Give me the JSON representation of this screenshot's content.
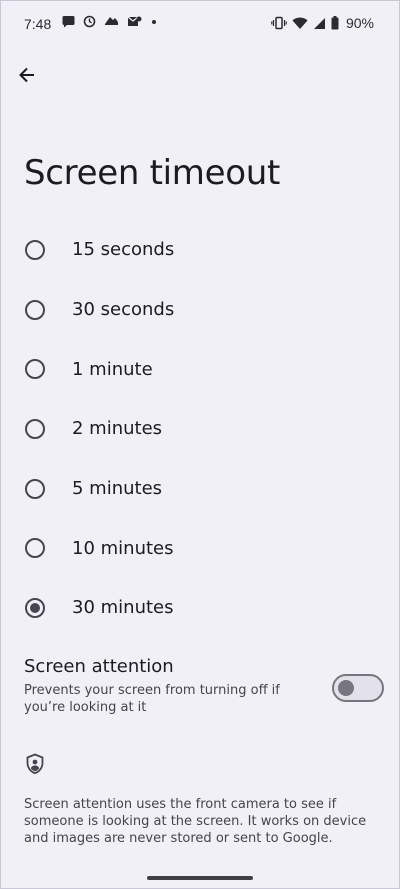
{
  "status_bar": {
    "time": "7:48",
    "battery_percent": "90%",
    "left_icons": [
      "chat-bubble-icon",
      "alarm-icon",
      "cloud-icon",
      "mail-icon",
      "dot-icon"
    ],
    "right_icons": [
      "vibrate-icon",
      "wifi-icon",
      "signal-icon",
      "battery-icon"
    ]
  },
  "header": {
    "back_icon": "arrow-left-icon",
    "title": "Screen timeout"
  },
  "options": [
    {
      "label": "15 seconds",
      "selected": false
    },
    {
      "label": "30 seconds",
      "selected": false
    },
    {
      "label": "1 minute",
      "selected": false
    },
    {
      "label": "2 minutes",
      "selected": false
    },
    {
      "label": "5 minutes",
      "selected": false
    },
    {
      "label": "10 minutes",
      "selected": false
    },
    {
      "label": "30 minutes",
      "selected": true
    }
  ],
  "screen_attention": {
    "title": "Screen attention",
    "description": "Prevents your screen from turning off if you’re looking at it",
    "enabled": false
  },
  "info": {
    "icon": "shield-person-icon",
    "text": "Screen attention uses the front camera to see if someone is looking at the screen. It works on device and images are never stored or sent to Google."
  },
  "colors": {
    "background": "#f1f0f7",
    "text_primary": "#1b1b21",
    "text_secondary": "#44444c",
    "control": "#45464f"
  }
}
